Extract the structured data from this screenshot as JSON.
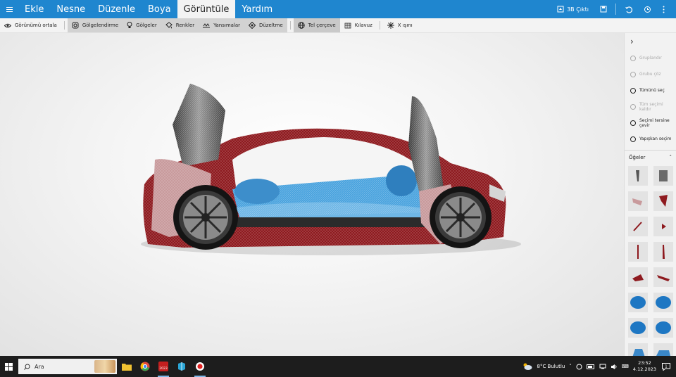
{
  "menu": {
    "items": [
      "Ekle",
      "Nesne",
      "Düzenle",
      "Boya",
      "Görüntüle",
      "Yardım"
    ],
    "active": "Görüntüle",
    "print3d_label": "3B Çıktı"
  },
  "toolbar": {
    "center_view": "Görünümü ortala",
    "shading": "Gölgelendirme",
    "shadows": "Gölgeler",
    "colors": "Renkler",
    "reflections": "Yansımalar",
    "smoothing": "Düzeltme",
    "wireframe": "Tel çerçeve",
    "guide": "Kılavuz",
    "xray": "X ışını"
  },
  "panel": {
    "actions": [
      {
        "label": "Gruplandır",
        "enabled": false
      },
      {
        "label": "Grubu çöz",
        "enabled": false
      },
      {
        "label": "Tümünü seç",
        "enabled": true
      },
      {
        "label": "Tüm seçimi kaldır",
        "enabled": false
      },
      {
        "label": "Seçimi tersine çevir",
        "enabled": true
      },
      {
        "label": "Yapışkan seçim",
        "enabled": true
      }
    ],
    "items_header": "Öğeler"
  },
  "taskbar": {
    "search_placeholder": "Ara",
    "weather": "8°C  Bulutlu",
    "time": "23:52",
    "date": "4.12.2023",
    "notification_count": "1",
    "badge_year": "2023"
  },
  "colors": {
    "accent": "#1f86cf",
    "car_body": "#8e1a1f",
    "floor_blue": "#4aa3de"
  }
}
